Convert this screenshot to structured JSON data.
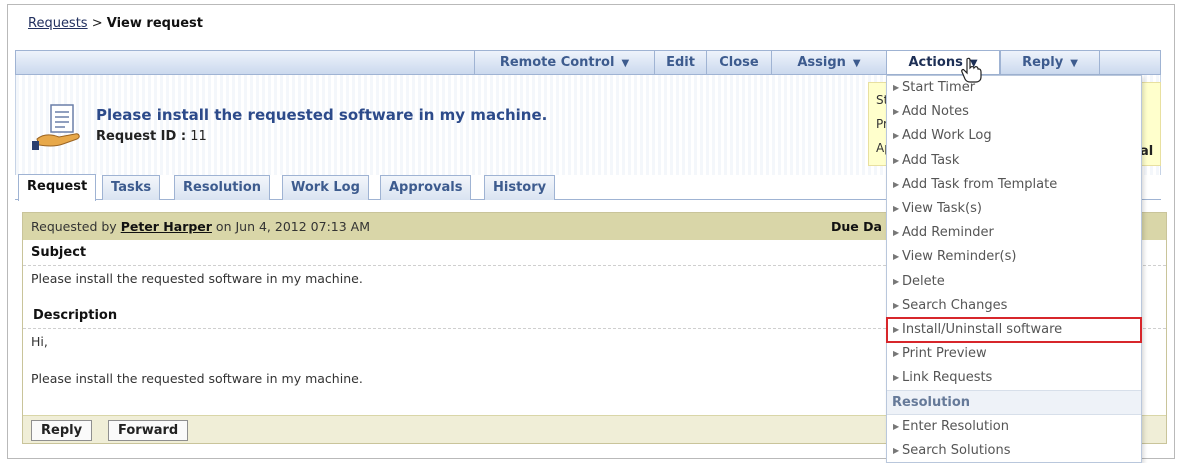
{
  "breadcrumb": {
    "link": "Requests",
    "separator": " > ",
    "current": "View request"
  },
  "toolbar": {
    "remote_control": "Remote Control",
    "edit": "Edit",
    "close": "Close",
    "assign": "Assign",
    "actions": "Actions",
    "reply": "Reply",
    "dropdown_icon": "chevron-down-icon"
  },
  "request": {
    "title": "Please install the requested software in my machine.",
    "id_label": "Request ID :",
    "id_value": "11",
    "icon": "request-document-hand-icon"
  },
  "status_box": {
    "line1": "St",
    "line2": "Pr",
    "line3": "Ap",
    "tail": "al"
  },
  "tabs": [
    "Request",
    "Tasks",
    "Resolution",
    "Work Log",
    "Approvals",
    "History"
  ],
  "content": {
    "requested_by_prefix": "Requested by ",
    "requester": "Peter Harper",
    "requested_on": " on Jun 4, 2012 07:13 AM",
    "due_date_label": "Due Da",
    "subject_label": "Subject",
    "subject_text": "Please install the requested software in my machine.",
    "description_label": "Description",
    "desc_line1": "Hi,",
    "desc_line2": "Please install the requested software in my machine.",
    "reply_button": "Reply",
    "forward_button": "Forward"
  },
  "actions_menu": {
    "items": [
      "Start Timer",
      "Add Notes",
      "Add Work Log",
      "Add Task",
      "Add Task from Template",
      "View Task(s)",
      "Add Reminder",
      "View Reminder(s)",
      "Delete",
      "Search Changes",
      "Install/Uninstall software",
      "Print Preview",
      "Link Requests"
    ],
    "section_resolution": "Resolution",
    "resolution_items": [
      "Enter Resolution",
      "Search Solutions"
    ],
    "highlighted": "Install/Uninstall software"
  },
  "colors": {
    "accent": "#3d5b8e",
    "title": "#2c4a8a",
    "highlight_border": "#d7262b",
    "status_bg": "#ffffcc",
    "content_header": "#d9d6a8"
  }
}
